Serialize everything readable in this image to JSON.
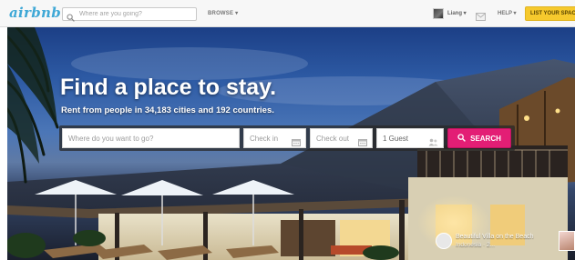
{
  "header": {
    "logo": "airbnb",
    "search_placeholder": "Where are you going?",
    "browse_label": "BROWSE ▾",
    "user_name": "Liang ▾",
    "help_label": "HELP ▾",
    "list_space_label": "LIST YOUR SPACE"
  },
  "hero": {
    "headline": "Find a place to stay.",
    "subline": "Rent from people in 34,183 cities and 192 countries.",
    "where_placeholder": "Where do you want to go?",
    "checkin_placeholder": "Check in",
    "checkout_placeholder": "Check out",
    "guests_value": "1 Guest",
    "search_button_label": "SEARCH",
    "caption_title": "Beautiful Villa on the Beach",
    "caption_subtitle": "Indonesia · 2..."
  },
  "colors": {
    "brand": "#3fa8d6",
    "list_space_bg": "#f6c92d",
    "search_button_bg": "#e31e75"
  },
  "icons": [
    "search-icon",
    "avatar",
    "mail-icon",
    "calendar-icon",
    "guests-icon",
    "search-button-icon"
  ]
}
